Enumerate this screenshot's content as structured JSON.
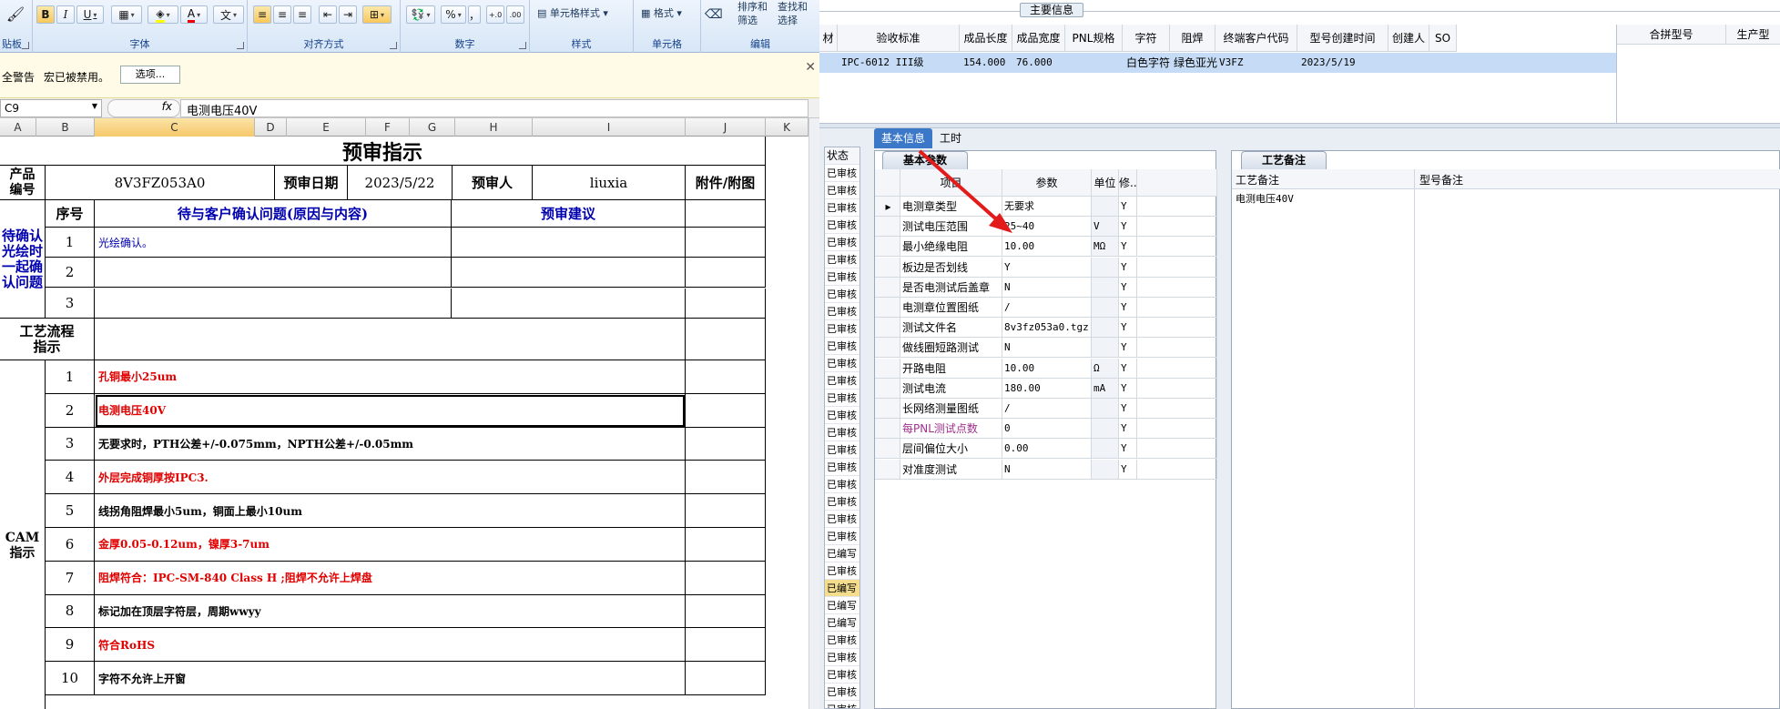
{
  "ribbon": {
    "clipboard_partial": "贴板",
    "bold": "B",
    "italic": "I",
    "underline": "U",
    "font_color_btn": "A",
    "wen": "文",
    "font_group": "字体",
    "align_group": "对齐方式",
    "number_group": "数字",
    "number_pct": "%",
    "number_comma": "，",
    "style_group": "样式",
    "cell_style": "单元格样式",
    "cells_group": "单元格",
    "format": "格式",
    "edit_group": "编辑",
    "sort_filter": "排序和\n筛选",
    "find_select": "查找和\n选择"
  },
  "security": {
    "warning": "全警告",
    "message": "宏已被禁用。",
    "options_button": "选项..."
  },
  "formula_bar": {
    "name_box": "C9",
    "fx": "fx",
    "content": "电测电压40V"
  },
  "columns": [
    "A",
    "B",
    "C",
    "D",
    "E",
    "F",
    "G",
    "H",
    "I",
    "J",
    "K"
  ],
  "sheet": {
    "title": "预审指示",
    "product_label": "产品\n编号",
    "product_code": "8V3FZ053A0",
    "review_date_label": "预审日期",
    "review_date": "2023/5/22",
    "reviewer_label": "预审人",
    "reviewer": "liuxia",
    "attachment_label": "附件/附图",
    "pending_label": "待确认\n光绘时\n一起确\n认问题",
    "seq_label": "序号",
    "question_header": "待与客户确认问题(原因与内容)",
    "suggest_header": "预审建议",
    "pending_rows": [
      {
        "no": "1",
        "text": "光绘确认。"
      },
      {
        "no": "2",
        "text": ""
      },
      {
        "no": "3",
        "text": ""
      }
    ],
    "process_label": "工艺流程\n指示",
    "cam_label": "CAM\n指示",
    "cam_rows": [
      {
        "no": "1",
        "text": "孔铜最小25um",
        "red": true
      },
      {
        "no": "2",
        "text": "电测电压40V",
        "red": true
      },
      {
        "no": "3",
        "text": "无要求时，PTH公差+/-0.075mm，NPTH公差+/-0.05mm",
        "red": false
      },
      {
        "no": "4",
        "text": "外层完成铜厚按IPC3.",
        "red": true
      },
      {
        "no": "5",
        "text": "线拐角阻焊最小5um，铜面上最小10um",
        "red": false
      },
      {
        "no": "6",
        "text": "金厚0.05-0.12um，镍厚3-7um",
        "red": true
      },
      {
        "no": "7",
        "text": "阻焊符合：IPC-SM-840 Class H ;阻焊不允许上焊盘",
        "red": true
      },
      {
        "no": "8",
        "text": "标记加在顶层字符层，周期wwyy",
        "red": false
      },
      {
        "no": "9",
        "text": "符合RoHS",
        "red": true
      },
      {
        "no": "10",
        "text": "字符不允许上开窗",
        "red": false
      }
    ]
  },
  "app": {
    "main_info": "主要信息",
    "headers": [
      "材",
      "验收标准",
      "成品长度",
      "成品宽度",
      "PNL规格",
      "字符",
      "阻焊",
      "终端客户代码",
      "型号创建时间",
      "创建人",
      "SO"
    ],
    "row": [
      "",
      "IPC-6012 III级",
      "154.000",
      "76.000",
      "",
      "白色字符",
      "绿色亚光",
      "V3FZ",
      "2023/5/19",
      "",
      ""
    ],
    "side_headers": [
      "合拼型号",
      "生产型"
    ],
    "status_header": "状态",
    "statuses": [
      "已审核",
      "已审核",
      "已审核",
      "已审核",
      "已审核",
      "已审核",
      "已审核",
      "已审核",
      "已审核",
      "已审核",
      "已审核",
      "已审核",
      "已审核",
      "已审核",
      "已审核",
      "已审核",
      "已审核",
      "已审核",
      "已审核",
      "已审核",
      "已审核",
      "已审核",
      "已编写",
      "已审核",
      "已编写",
      "已编写",
      "已编写",
      "已审核",
      "已审核",
      "已审核",
      "已审核",
      "已审核"
    ],
    "tabs": [
      "基本信息",
      "工时"
    ],
    "subtab": "基本参数",
    "param_headers": [
      "项目",
      "参数",
      "单位",
      "修..."
    ],
    "params": [
      {
        "item": "电测章类型",
        "value": "无要求",
        "unit": "",
        "mod": "Y"
      },
      {
        "item": "测试电压范围",
        "value": "25~40",
        "unit": "V",
        "mod": "Y"
      },
      {
        "item": "最小绝缘电阻",
        "value": "10.00",
        "unit": "MΩ",
        "mod": "Y"
      },
      {
        "item": "板边是否划线",
        "value": "Y",
        "unit": "",
        "mod": "Y"
      },
      {
        "item": "是否电测试后盖章",
        "value": "N",
        "unit": "",
        "mod": "Y"
      },
      {
        "item": "电测章位置图纸",
        "value": "/",
        "unit": "",
        "mod": "Y"
      },
      {
        "item": "测试文件名",
        "value": "8v3fz053a0.tgz",
        "unit": "",
        "mod": "Y"
      },
      {
        "item": "做线圈短路测试",
        "value": "N",
        "unit": "",
        "mod": "Y"
      },
      {
        "item": "开路电阻",
        "value": "10.00",
        "unit": "Ω",
        "mod": "Y"
      },
      {
        "item": "测试电流",
        "value": "180.00",
        "unit": "mA",
        "mod": "Y"
      },
      {
        "item": "长网络测量图纸",
        "value": "/",
        "unit": "",
        "mod": "Y"
      },
      {
        "item": "每PNL测试点数",
        "value": "0",
        "unit": "",
        "mod": "Y",
        "purple": true
      },
      {
        "item": "层间偏位大小",
        "value": "0.00",
        "unit": "",
        "mod": "Y"
      },
      {
        "item": "对准度测试",
        "value": "N",
        "unit": "",
        "mod": "Y"
      }
    ],
    "process_tab": "工艺备注",
    "process_note_header": "工艺备注",
    "model_note_header": "型号备注",
    "process_note": "电测电压40V"
  }
}
